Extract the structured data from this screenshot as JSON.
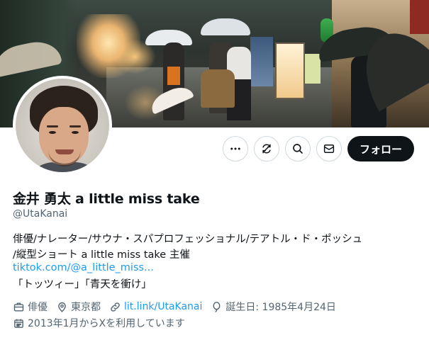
{
  "banner": {
    "description_icon": "street-photo"
  },
  "actions": {
    "more_icon": "more-dots-icon",
    "subscribe_icon": "notification-icon",
    "search_icon": "search-icon",
    "message_icon": "mail-icon",
    "follow_label": "フォロー"
  },
  "profile": {
    "display_name": "金井 勇太 a little miss take",
    "handle": "@UtaKanai",
    "bio_line1": "俳優/ナレーター/サウナ・スパプロフェッショナル/テアトル・ド・ポッシュ",
    "bio_line2": "/縦型ショート a little miss take 主催",
    "bio_link": "tiktok.com/@a_little_miss...",
    "bio_line3": "「トッツィー」「青天を衝け」"
  },
  "meta": {
    "profession": "俳優",
    "location": "東京都",
    "website": "lit.link/UtaKanai",
    "birthday": "誕生日: 1985年4月24日",
    "joined": "2013年1月からXを利用しています"
  },
  "colors": {
    "accent": "#1d9bf0",
    "text": "#0f1419",
    "secondary": "#536471",
    "follow_bg": "#0f1419"
  }
}
